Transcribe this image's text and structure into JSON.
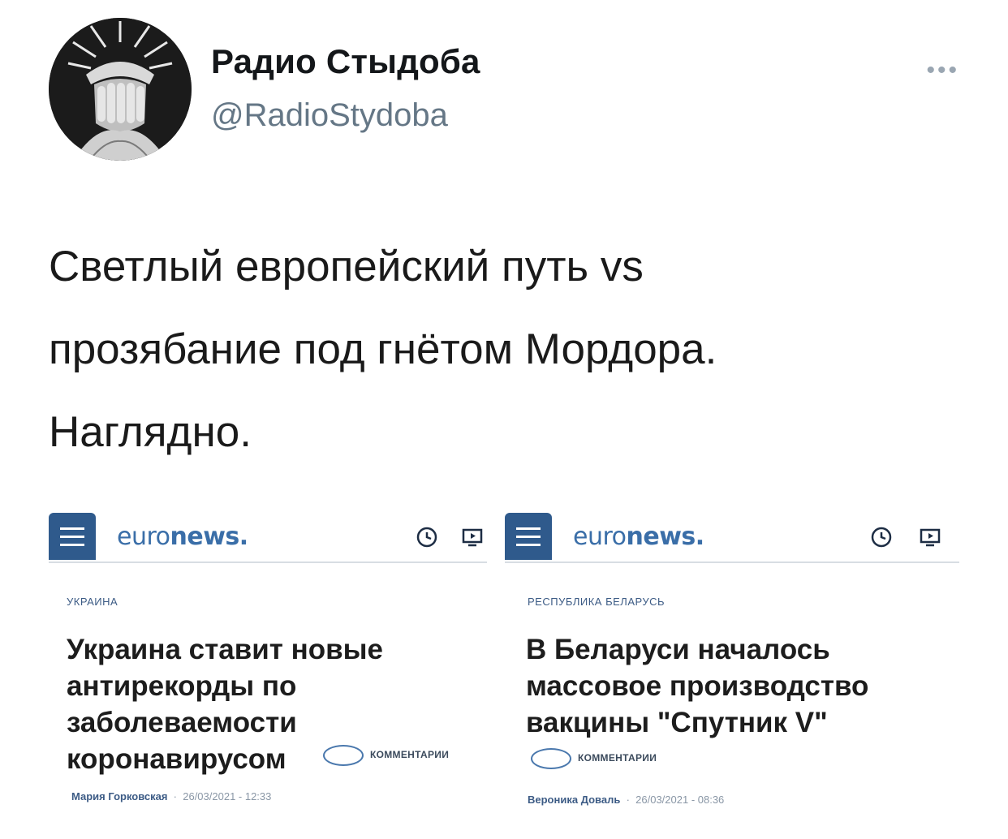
{
  "tweet": {
    "display_name": "Радио Стыдоба",
    "handle": "@RadioStydoba",
    "more_icon": "more-icon",
    "text_lines": [
      "Светлый европейский путь vs",
      "прозябание под гнётом Мордора.",
      "Наглядно."
    ]
  },
  "cards": [
    {
      "logo_prefix": "euro",
      "logo_suffix": "news.",
      "section": "УКРАИНА",
      "headline_lines": [
        "Украина ставит новые",
        "антирекорды по",
        "заболеваемости",
        "коронавирусом"
      ],
      "comments_label": "КОММЕНТАРИИ",
      "author": "Мария Горковская",
      "datetime": "26/03/2021 - 12:33"
    },
    {
      "logo_prefix": "euro",
      "logo_suffix": "news.",
      "section": "РЕСПУБЛИКА БЕЛАРУСЬ",
      "headline_lines": [
        "В Беларуси началось",
        "массовое производство",
        "вакцины \"Спутник V\""
      ],
      "comments_label": "КОММЕНТАРИИ",
      "author": "Вероника Доваль",
      "datetime": "26/03/2021 - 08:36"
    }
  ],
  "colors": {
    "euronews_blue": "#2f5a8c",
    "handle_gray": "#657786"
  }
}
